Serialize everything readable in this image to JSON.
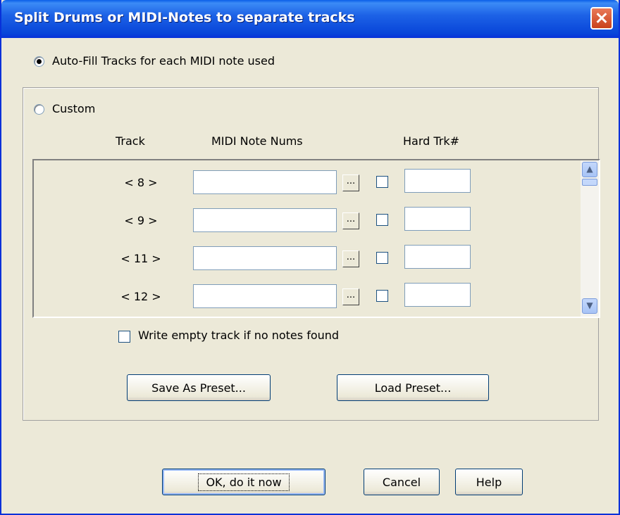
{
  "title": "Split Drums or MIDI-Notes to separate tracks",
  "auto_fill_label": "Auto-Fill Tracks for each MIDI note used",
  "custom_label": "Custom",
  "columns": {
    "track": "Track",
    "notes": "MIDI Note Nums",
    "hard": "Hard Trk#"
  },
  "rows": [
    {
      "track": "< 8 >",
      "notes": "",
      "dots": "...",
      "hard": ""
    },
    {
      "track": "< 9 >",
      "notes": "",
      "dots": "...",
      "hard": ""
    },
    {
      "track": "< 11 >",
      "notes": "",
      "dots": "...",
      "hard": ""
    },
    {
      "track": "< 12 >",
      "notes": "",
      "dots": "...",
      "hard": ""
    }
  ],
  "write_empty_label": "Write empty track if no notes found",
  "buttons": {
    "save_preset": "Save As Preset...",
    "load_preset": "Load Preset...",
    "ok": "OK, do it now",
    "cancel": "Cancel",
    "help": "Help"
  },
  "auto_fill_selected": true,
  "custom_selected": false
}
